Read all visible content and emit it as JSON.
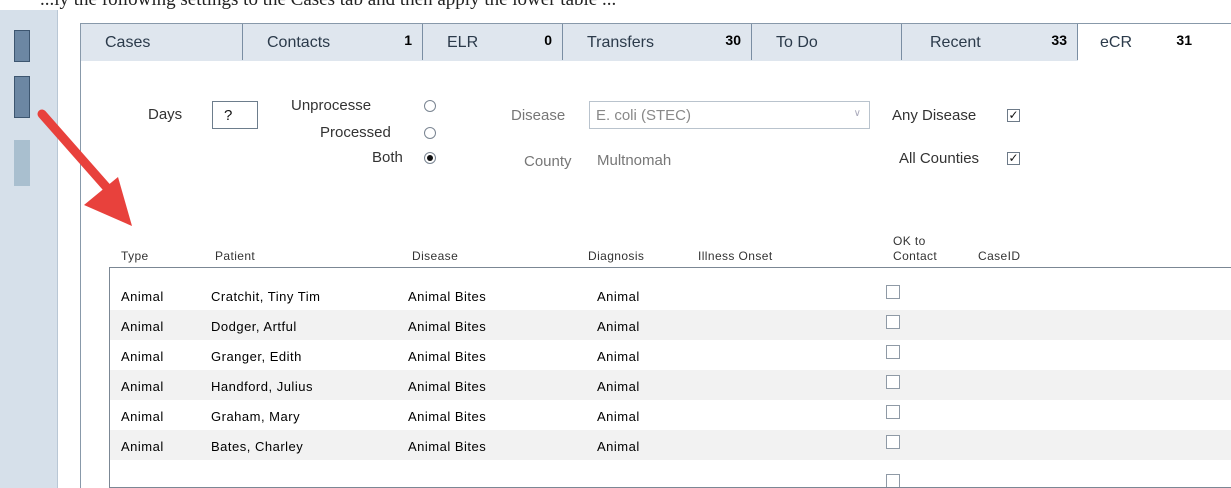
{
  "caption_fragment": "...ly the following settings to the Cases tab and then apply the lower table ...",
  "tabs": [
    {
      "label": "Cases",
      "count": ""
    },
    {
      "label": "Contacts",
      "count": "1"
    },
    {
      "label": "ELR",
      "count": "0"
    },
    {
      "label": "Transfers",
      "count": "30"
    },
    {
      "label": "To Do",
      "count": ""
    },
    {
      "label": "Recent",
      "count": "33"
    },
    {
      "label": "eCR",
      "count": "31",
      "active": true
    }
  ],
  "filters": {
    "days_label": "Days",
    "days_value": "?",
    "radio_unprocessed": "Unprocesse",
    "radio_processed": "Processed",
    "radio_both": "Both",
    "radio_selected": "Both",
    "disease_label": "Disease",
    "disease_value": "E. coli (STEC)",
    "county_label": "County",
    "county_value": "Multnomah",
    "any_disease_label": "Any Disease",
    "any_disease_checked": true,
    "all_counties_label": "All Counties",
    "all_counties_checked": true
  },
  "table": {
    "columns": [
      "Type",
      "Patient",
      "Disease",
      "Diagnosis",
      "Illness Onset",
      "OK to",
      "Contact",
      "CaseID"
    ],
    "rows": [
      {
        "type": "Animal",
        "patient": "Cratchit, Tiny Tim",
        "disease": "Animal Bites",
        "diagnosis": "Animal",
        "ok_to_contact": false
      },
      {
        "type": "Animal",
        "patient": "Dodger, Artful",
        "disease": "Animal Bites",
        "diagnosis": "Animal",
        "ok_to_contact": false
      },
      {
        "type": "Animal",
        "patient": "Granger, Edith",
        "disease": "Animal Bites",
        "diagnosis": "Animal",
        "ok_to_contact": false
      },
      {
        "type": "Animal",
        "patient": "Handford, Julius",
        "disease": "Animal Bites",
        "diagnosis": "Animal",
        "ok_to_contact": false
      },
      {
        "type": "Animal",
        "patient": "Graham, Mary",
        "disease": "Animal Bites",
        "diagnosis": "Animal",
        "ok_to_contact": false
      },
      {
        "type": "Animal",
        "patient": "Bates, Charley",
        "disease": "Animal Bites",
        "diagnosis": "Animal",
        "ok_to_contact": false
      }
    ]
  },
  "colors": {
    "tab_bg": "#dfe6ee",
    "rail_bg": "#d6e0ea",
    "arrow": "#e8413c"
  }
}
